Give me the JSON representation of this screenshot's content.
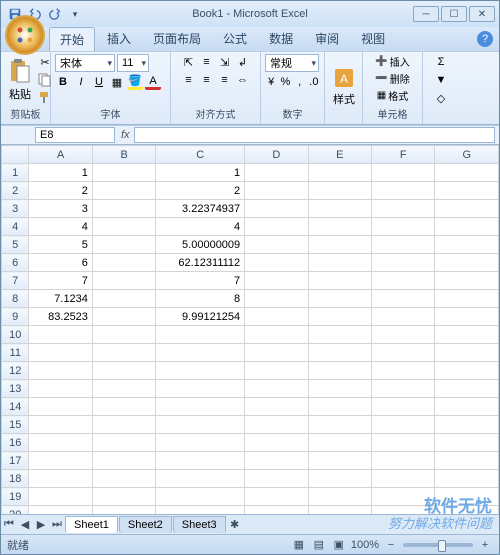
{
  "title": "Book1 - Microsoft Excel",
  "tabs": [
    "开始",
    "插入",
    "页面布局",
    "公式",
    "数据",
    "审阅",
    "视图"
  ],
  "active_tab": 0,
  "ribbon": {
    "clipboard": {
      "label": "剪贴板",
      "paste": "粘贴"
    },
    "font": {
      "label": "字体",
      "name": "宋体",
      "size": "11"
    },
    "align": {
      "label": "对齐方式"
    },
    "number": {
      "label": "数字",
      "format": "常规"
    },
    "styles": {
      "label": "样式",
      "btn": "样式"
    },
    "cells": {
      "label": "单元格",
      "insert": "插入",
      "delete": "删除",
      "format": "格式"
    },
    "editing": {
      "label": ""
    }
  },
  "namebox": "E8",
  "columns": [
    "",
    "A",
    "B",
    "C",
    "D",
    "E",
    "F",
    "G"
  ],
  "rows": 21,
  "cells": {
    "r1": {
      "A": "1",
      "C": "1"
    },
    "r2": {
      "A": "2",
      "C": "2"
    },
    "r3": {
      "A": "3",
      "C": "3.22374937"
    },
    "r4": {
      "A": "4",
      "C": "4"
    },
    "r5": {
      "A": "5",
      "C": "5.00000009"
    },
    "r6": {
      "A": "6",
      "C": "62.12311112"
    },
    "r7": {
      "A": "7",
      "C": "7"
    },
    "r8": {
      "A": "7.1234",
      "C": "8"
    },
    "r9": {
      "A": "83.2523",
      "C": "9.99121254"
    }
  },
  "sheets": [
    "Sheet1",
    "Sheet2",
    "Sheet3"
  ],
  "active_sheet": 0,
  "status": "就绪",
  "zoom": "100%",
  "watermark": {
    "big": "软件无忧",
    "small": "努力解决软件问题"
  }
}
